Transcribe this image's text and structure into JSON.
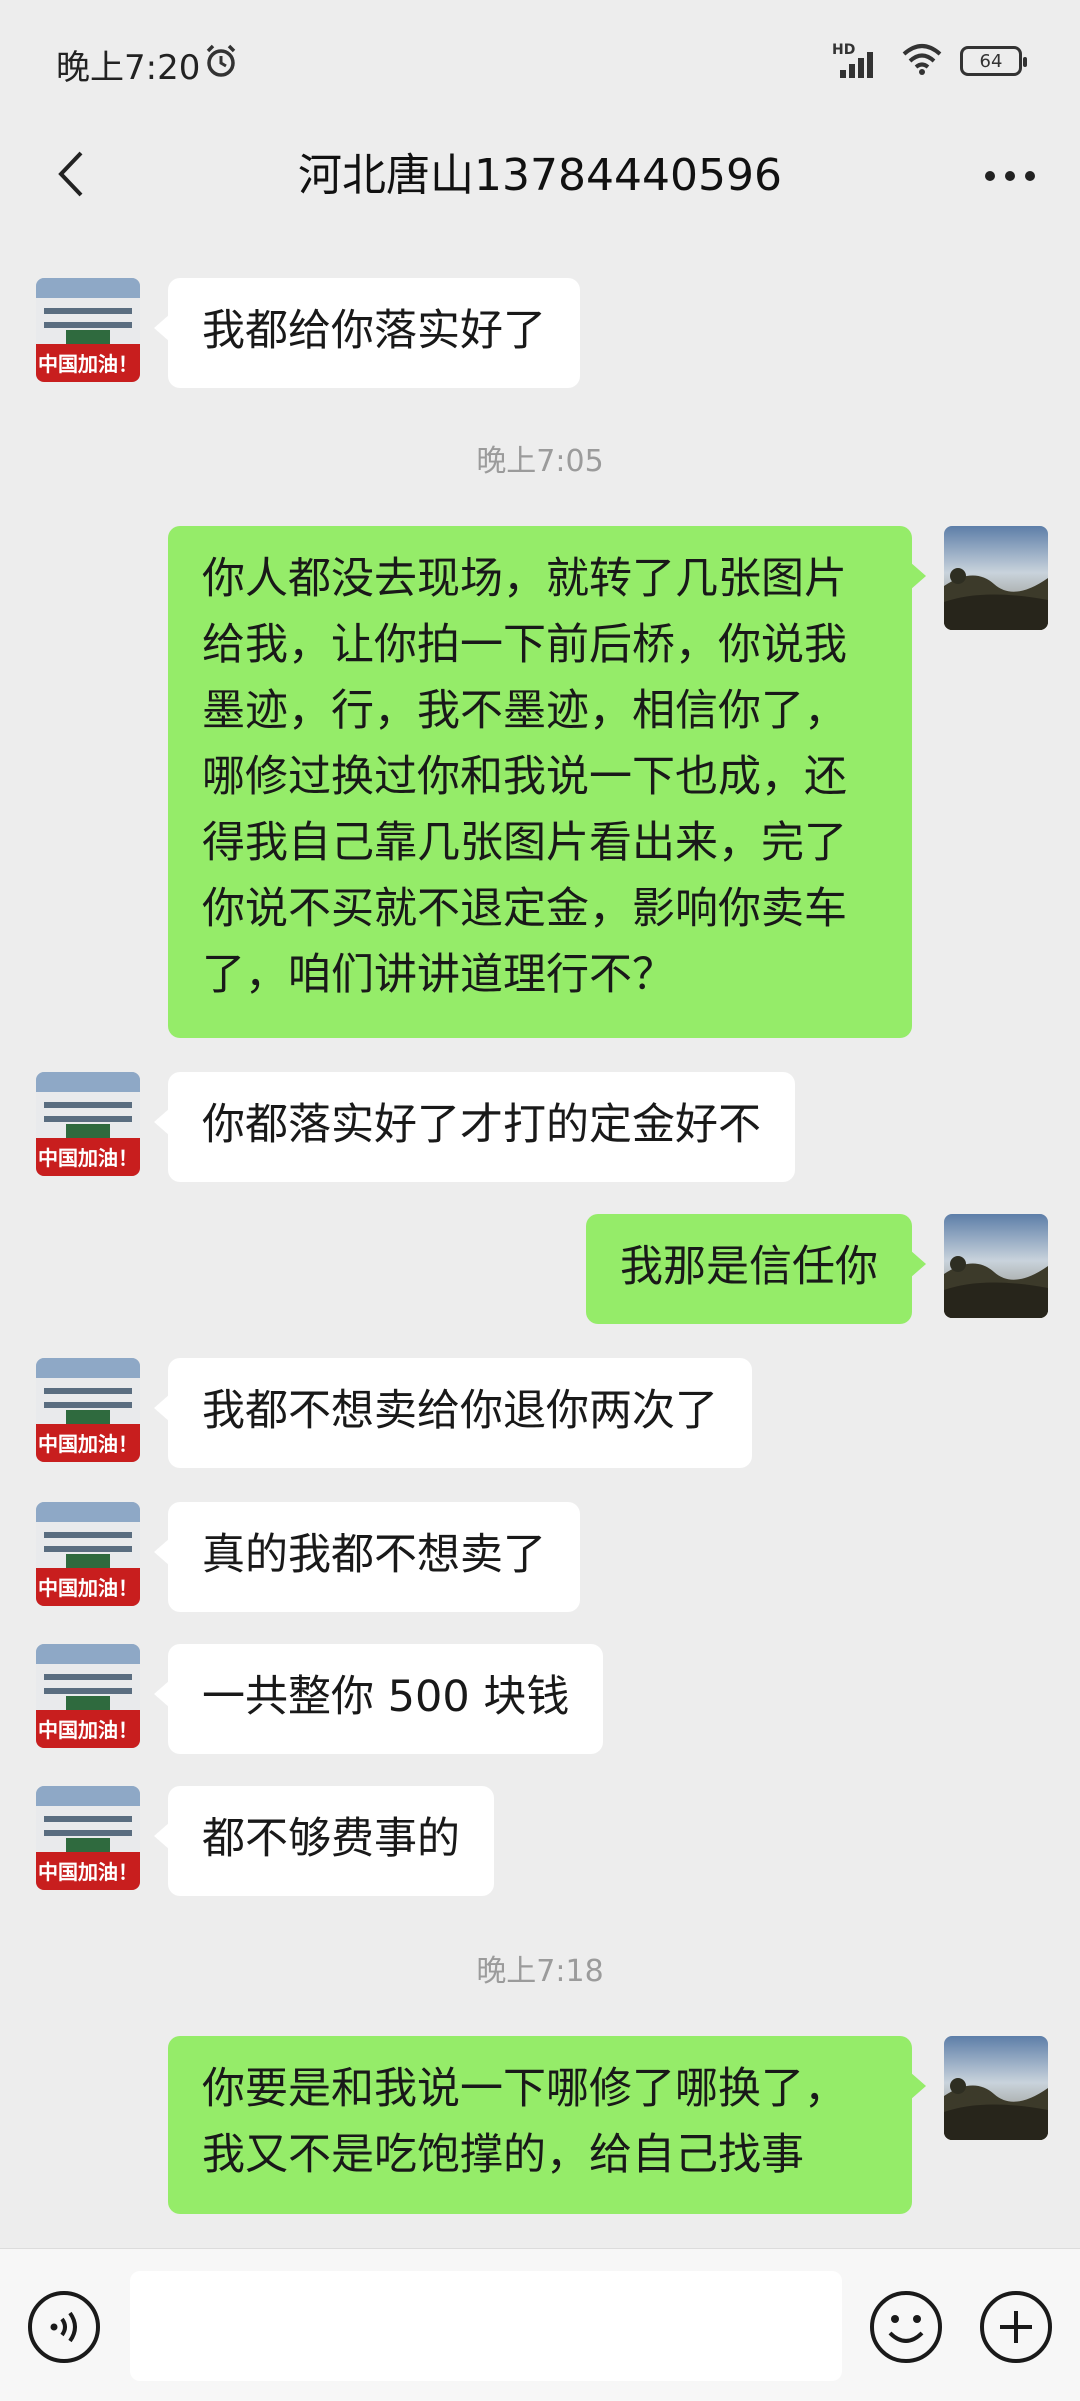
{
  "status_bar": {
    "time": "晚上7:20",
    "network": "HD",
    "battery": "64"
  },
  "header": {
    "title": "河北唐山13784440596"
  },
  "avatars": {
    "other_caption": "中国加油！"
  },
  "messages": [
    {
      "type": "msg",
      "side": "in",
      "text": "我都给你落实好了"
    },
    {
      "type": "time",
      "text": "晚上7:05"
    },
    {
      "type": "msg",
      "side": "out",
      "text": "你人都没去现场，就转了几张图片给我，让你拍一下前后桥，你说我墨迹，行，我不墨迹，相信你了，哪修过换过你和我说一下也成，还得我自己靠几张图片看出来，完了你说不买就不退定金，影响你卖车了，咱们讲讲道理行不？"
    },
    {
      "type": "msg",
      "side": "in",
      "text": "你都落实好了才打的定金好不"
    },
    {
      "type": "msg",
      "side": "out",
      "text": "我那是信任你"
    },
    {
      "type": "msg",
      "side": "in",
      "text": "我都不想卖给你退你两次了"
    },
    {
      "type": "msg",
      "side": "in",
      "text": "真的我都不想卖了"
    },
    {
      "type": "msg",
      "side": "in",
      "text": "一共整你 500 块钱"
    },
    {
      "type": "msg",
      "side": "in",
      "text": "都不够费事的"
    },
    {
      "type": "time",
      "text": "晚上7:18"
    },
    {
      "type": "msg",
      "side": "out",
      "text": "你要是和我说一下哪修了哪换了，我又不是吃饱撑的，给自己找事"
    }
  ],
  "colors": {
    "background": "#ededed",
    "incoming_bubble": "#ffffff",
    "outgoing_bubble": "#95ec69",
    "timestamp": "#9b9b9b"
  },
  "icons": {
    "back": "chevron-left-icon",
    "more": "more-dots-icon",
    "voice": "voice-icon",
    "emoji": "emoji-icon",
    "plus": "plus-icon",
    "alarm": "alarm-icon",
    "wifi": "wifi-icon",
    "signal": "signal-icon",
    "battery": "battery-icon"
  }
}
